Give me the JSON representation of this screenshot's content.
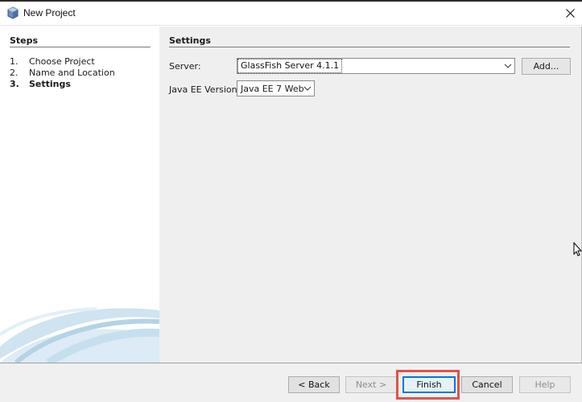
{
  "window": {
    "title": "New Project",
    "icons": {
      "app": "netbeans-cube-icon",
      "close": "close-icon"
    }
  },
  "steps": {
    "heading": "Steps",
    "items": [
      {
        "number": "1.",
        "label": "Choose Project",
        "current": false
      },
      {
        "number": "2.",
        "label": "Name and Location",
        "current": false
      },
      {
        "number": "3.",
        "label": "Settings",
        "current": true
      }
    ]
  },
  "settings": {
    "heading": "Settings",
    "server_label": "Server:",
    "server_value": "GlassFish Server 4.1.1",
    "add_label": "Add...",
    "javaee_label": "Java EE Version:",
    "javaee_value": "Java EE 7 Web"
  },
  "buttons": {
    "back": "< Back",
    "next": "Next >",
    "finish": "Finish",
    "cancel": "Cancel",
    "help": "Help"
  },
  "colors": {
    "highlight": "#e0524c",
    "focus": "#0078d7",
    "panel": "#efefef"
  }
}
